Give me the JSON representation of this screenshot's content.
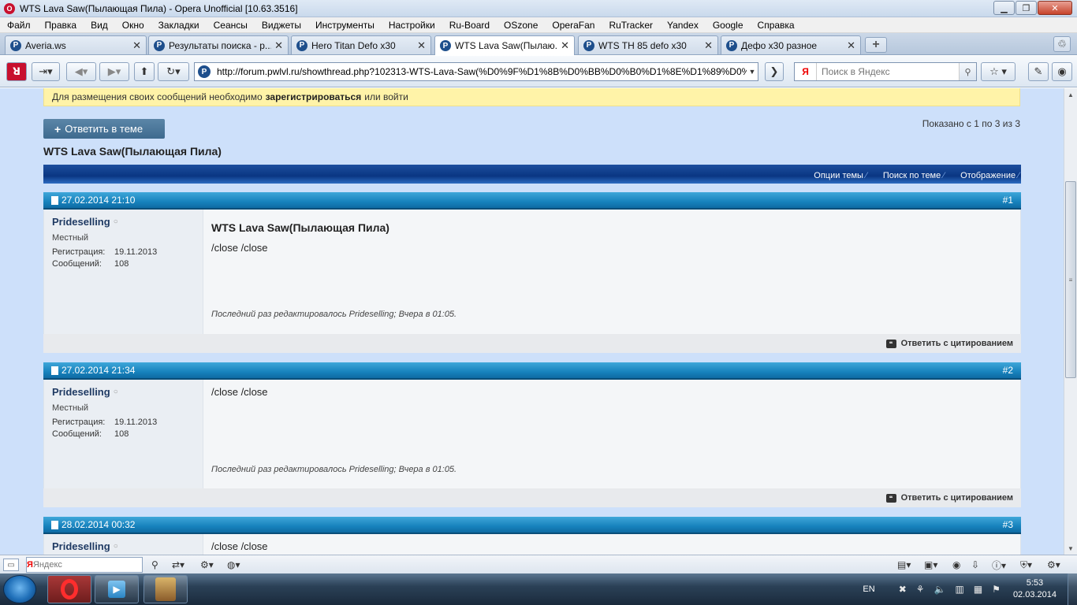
{
  "window": {
    "title": "WTS Lava Saw(Пылающая Пила) - Opera Unofficial [10.63.3516]",
    "buttons": {
      "minimize": "▁",
      "maximize": "❐",
      "close": "✕"
    }
  },
  "menu": [
    "Файл",
    "Правка",
    "Вид",
    "Окно",
    "Закладки",
    "Сеансы",
    "Виджеты",
    "Инструменты",
    "Настройки",
    "Ru-Board",
    "OSzone",
    "OperaFan",
    "RuTracker",
    "Yandex",
    "Google",
    "Справка"
  ],
  "tabs": [
    {
      "label": "Averia.ws",
      "icon": "P"
    },
    {
      "label": "Результаты поиска - р...",
      "icon": "P"
    },
    {
      "label": "Hero Titan Defo x30",
      "icon": "P"
    },
    {
      "label": "WTS Lava Saw(Пылаю...",
      "icon": "P"
    },
    {
      "label": "WTS TH 85 defo x30",
      "icon": "P"
    },
    {
      "label": "Дефо x30 разное",
      "icon": "P"
    }
  ],
  "active_tab": 3,
  "address": {
    "url": "http://forum.pwlvl.ru/showthread.php?102313-WTS-Lava-Saw(%D0%9F%D1%8B%D0%BB%D0%B0%D1%8E%D1%89%D0%B0%D1%8F-%D0%9F%D0%B8%D0%BB%D0%B0)"
  },
  "search": {
    "engine": "Я",
    "placeholder": "Поиск в Яндекс"
  },
  "page": {
    "notice_prefix": "Для размещения своих сообщений необходимо",
    "notice_link": "зарегистрироваться",
    "notice_suffix": "или войти",
    "reply_button": "Ответить в теме",
    "shown": "Показано с 1 по 3 из 3",
    "thread_title": "WTS Lava Saw(Пылающая Пила)",
    "tools": [
      "Опции темы",
      "Поиск по теме",
      "Отображение"
    ]
  },
  "posts": [
    {
      "date": "27.02.2014 21:10",
      "number": "#1",
      "username": "Prideselling",
      "usertitle": "Местный",
      "reg_label": "Регистрация:",
      "reg_date": "19.11.2013",
      "posts_label": "Сообщений:",
      "posts_count": "108",
      "title": "WTS Lava Saw(Пылающая Пила)",
      "text": "/close /close",
      "edited": "Последний раз редактировалось Prideselling; Вчера в 01:05.",
      "quote": "Ответить с цитированием"
    },
    {
      "date": "27.02.2014 21:34",
      "number": "#2",
      "username": "Prideselling",
      "usertitle": "Местный",
      "reg_label": "Регистрация:",
      "reg_date": "19.11.2013",
      "posts_label": "Сообщений:",
      "posts_count": "108",
      "title": "",
      "text": "/close /close",
      "edited": "Последний раз редактировалось Prideselling; Вчера в 01:05.",
      "quote": "Ответить с цитированием"
    },
    {
      "date": "28.02.2014 00:32",
      "number": "#3",
      "username": "Prideselling",
      "text": "/close /close"
    }
  ],
  "statusbar": {
    "search_placeholder": "Яндекс",
    "search_engine": "Я"
  },
  "taskbar": {
    "lang": "EN",
    "time": "5:53",
    "date": "02.03.2014"
  }
}
